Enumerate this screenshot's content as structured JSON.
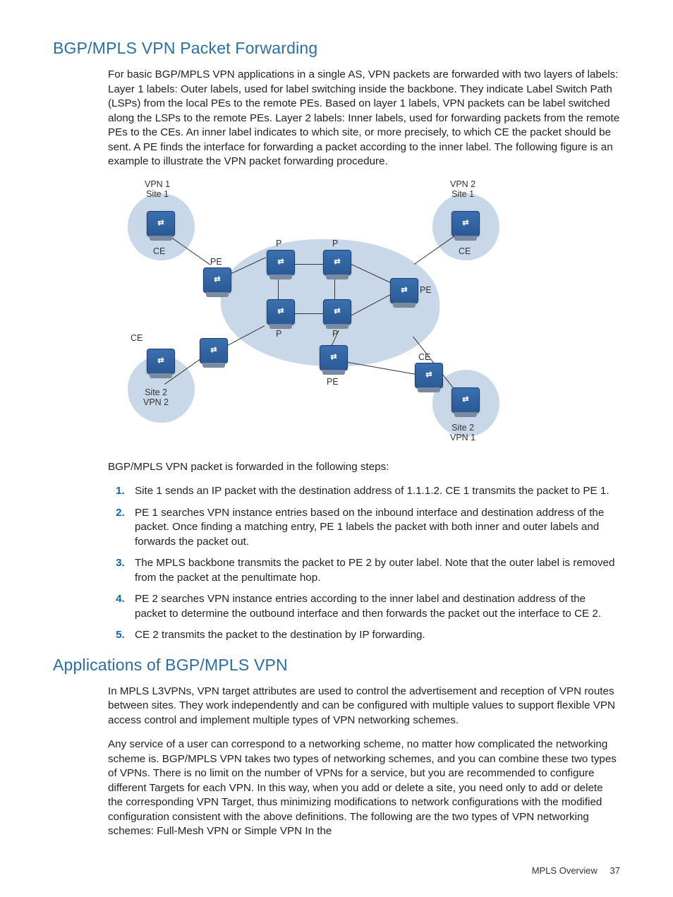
{
  "section1": {
    "heading": "BGP/MPLS VPN Packet Forwarding",
    "para1": "For basic BGP/MPLS VPN applications in a single AS, VPN packets are forwarded with two layers of labels: Layer 1 labels: Outer labels, used for label switching inside the backbone. They indicate Label Switch Path (LSPs) from the local PEs to the remote PEs. Based on layer 1 labels, VPN packets can be label switched along the LSPs to the remote PEs. Layer 2 labels: Inner labels, used for forwarding packets from the remote PEs to the CEs. An inner label indicates to which site, or more precisely, to which CE the packet should be sent. A PE finds the interface for forwarding a packet according to the inner label. The following figure is an example to illustrate the VPN packet forwarding procedure.",
    "intro_steps": "BGP/MPLS VPN packet is forwarded in the following steps:",
    "steps": [
      "Site 1 sends an IP packet with the destination address of 1.1.1.2. CE 1 transmits the packet to PE 1.",
      "PE 1 searches VPN instance entries based on the inbound interface and destination address of the packet. Once finding a matching entry, PE 1 labels the packet with both inner and outer labels and forwards the packet out.",
      "The MPLS backbone transmits the packet to PE 2 by outer label. Note that the outer label is removed from the packet at the penultimate hop.",
      "PE 2 searches VPN instance entries according to the inner label and destination address of the packet to determine the outbound interface and then forwards the packet out the interface to CE 2.",
      "CE 2 transmits the packet to the destination by IP forwarding."
    ]
  },
  "diagram": {
    "labels": {
      "vpn1_site1": "VPN 1\nSite 1",
      "vpn2_site1": "VPN 2\nSite 1",
      "site2_vpn2": "Site 2\nVPN 2",
      "site2_vpn1": "Site 2\nVPN 1",
      "ce": "CE",
      "pe": "PE",
      "p": "P"
    }
  },
  "section2": {
    "heading": "Applications of BGP/MPLS VPN",
    "para1": "In MPLS L3VPNs, VPN target attributes are used to control the advertisement and reception of VPN routes between sites. They work independently and can be configured with multiple values to support flexible VPN access control and implement multiple types of VPN networking schemes.",
    "para2": "Any service of a user can correspond to a networking scheme, no matter how complicated the networking scheme is. BGP/MPLS VPN takes two types of networking schemes, and you can combine these two types of VPNs. There is no limit on the number of VPNs for a service, but you are recommended to configure different Targets for each VPN. In this way, when you add or delete a site, you need only to add or delete the corresponding VPN Target, thus minimizing modifications to network configurations with the modified configuration consistent with the above definitions. The following are the two types of VPN networking schemes: Full-Mesh VPN or Simple VPN In the"
  },
  "footer": {
    "section": "MPLS Overview",
    "page": "37"
  }
}
